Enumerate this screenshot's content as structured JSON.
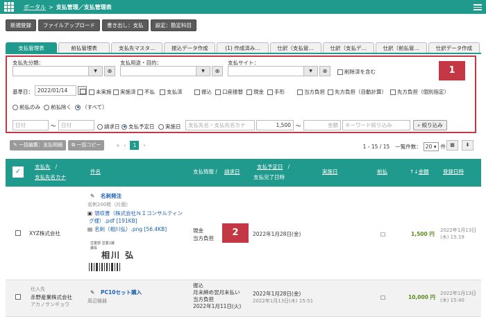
{
  "breadcrumb": {
    "portal": "ポータル",
    "sep": ">",
    "current": "支払管理／支払管理表"
  },
  "toolbar": {
    "new": "新規登録",
    "upload": "ファイルアップロード",
    "export": "書き出し：支払",
    "settings": "設定：勘定科目"
  },
  "tabs": [
    "支払管理表",
    "前払管理表",
    "支払先マスタ…",
    "振込データ作成",
    "(1) 作成済み…",
    "仕訳（支払管…",
    "仕訳（支払デ…",
    "仕訳（前払管…",
    "仕訳データ作成"
  ],
  "filter": {
    "payee_category_label": "支払先分類：",
    "purpose_label": "支払用途・目的：",
    "site_label": "支払サイト：",
    "include_deleted": "削除済を含む",
    "base_date_label": "基準日：",
    "base_date": "2022/01/14",
    "status_options": [
      "未実施",
      "実施済",
      "不払",
      "支払済"
    ],
    "method_options": [
      "振込",
      "口座振替",
      "現金",
      "手形"
    ],
    "burden_options": [
      "当方負担",
      "先方負担（自動計算）",
      "先方負担（個別指定）"
    ],
    "prepay_options": [
      "前払のみ",
      "前払除く",
      "（すべて）"
    ],
    "date_from_placeholder": "日付",
    "tilde": "〜",
    "date_to_placeholder": "日付",
    "date_type_options": [
      "請求日",
      "支払予定日",
      "実施日"
    ],
    "name_placeholder": "支払先名・支払先名カナ",
    "amount_from": "1,500",
    "amount_to_placeholder": "金額",
    "keyword_placeholder": "キーワード絞り込み",
    "search_button": "絞り込み",
    "badge": "1"
  },
  "actions": {
    "bulk_edit": "一括編集：支払明細",
    "bulk_copy": "一括コピー",
    "first": "«",
    "prev": "‹",
    "page": "1",
    "next": "›",
    "count": "1 - 15 / 15",
    "per_page_label": "一覧件数：",
    "per_page": "20",
    "per_page_unit": "件"
  },
  "table": {
    "headers": {
      "payee": "支払先",
      "slash": "/",
      "payee_kana": "支払先名カナ",
      "subject": "件名",
      "pay_info": "支払情報 /",
      "invoice_date": "請求日",
      "due_date": "支払予定日",
      "done_datetime": "支払完了日時",
      "executed": "実施日",
      "prepay": "前払",
      "amount": "金額",
      "sort_mark": "↑↓",
      "registered": "登録日時"
    },
    "rows": [
      {
        "category": "",
        "payee": "XYZ株式会社",
        "kana": "",
        "subject": "名刺発注",
        "subject_sub": "名刺100枚（片面）",
        "file1": "領収書（株式会社ＮＩコンサルティング様）.pdf [191KB]",
        "file1_a": "領収書（株式会社ＮＩコンサルティン",
        "file1_b": "グ様）.pdf [191KB]",
        "file2": "名刺（相川弘）.png [56.4KB]",
        "card_title": "営業部 営業1課",
        "card_role": "課長",
        "card_name": "相川 弘",
        "pay_method": "現金",
        "burden": "当方負担",
        "badge": "2",
        "due_date": "2022年1月28日(金)",
        "done": "",
        "prepay": "□",
        "amount": "1,500 円",
        "reg_date": "2022年1月13日",
        "reg_time": "(木) 15:19"
      },
      {
        "category": "仕入先",
        "payee": "赤野産業株式会社",
        "kana": "アカノサンギョウ",
        "subject": "PC10セット購入",
        "subject_sub": "周辺機器",
        "pay_method": "振込",
        "pay_term": "月末締め翌月末払い",
        "burden": "当方負担",
        "invoice_date": "2022年1月11日(火)",
        "due_date": "2022年1月28日(金)",
        "done": "2022年1月13日(木) 15:51",
        "prepay": "□",
        "amount": "10,000 円",
        "reg_date": "2022年1月13日",
        "reg_time": "(木) 15:40"
      }
    ]
  }
}
